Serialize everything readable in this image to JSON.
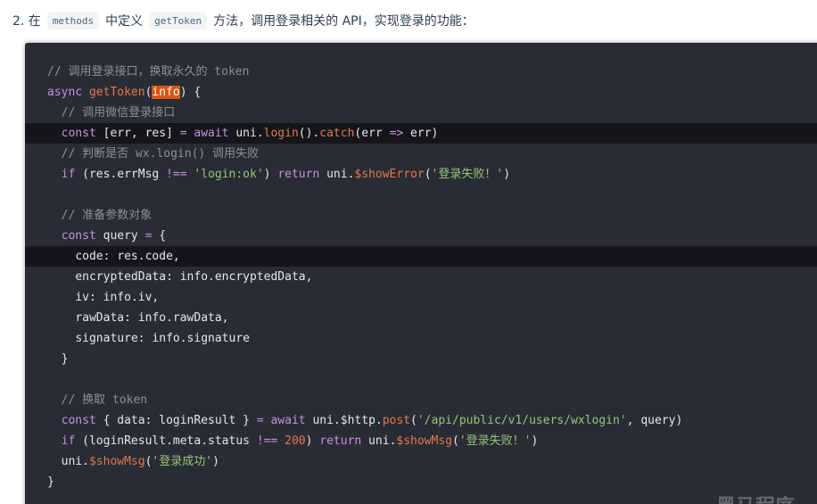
{
  "intro": {
    "prefix": "2. 在",
    "chip1": "methods",
    "mid": "中定义",
    "chip2": "getToken",
    "suffix": "方法，调用登录相关的 API，实现登录的功能："
  },
  "code": {
    "l1": "// 调用登录接口，换取永久的 token",
    "l2_kw": "async",
    "l2_fn": "getToken",
    "l2_open": "(",
    "l2_cursor": "info",
    "l2_close": ") {",
    "l3": "// 调用微信登录接口",
    "l4_a": "const",
    "l4_b": " [err, res] ",
    "l4_c": "=",
    "l4_d": " ",
    "l4_e": "await",
    "l4_f": " uni.",
    "l4_g": "login",
    "l4_h": "().",
    "l4_i": "catch",
    "l4_j": "(err ",
    "l4_k": "=>",
    "l4_l": " err)",
    "l5": "// 判断是否 wx.login() 调用失败",
    "l6_a": "if",
    "l6_b": " (res.errMsg ",
    "l6_c": "!==",
    "l6_d": " ",
    "l6_e": "'login:ok'",
    "l6_f": ") ",
    "l6_g": "return",
    "l6_h": " uni.",
    "l6_i": "$showError",
    "l6_j": "(",
    "l6_k": "'登录失败！'",
    "l6_l": ")",
    "l8": "// 准备参数对象",
    "l9_a": "const",
    "l9_b": " query ",
    "l9_c": "=",
    "l9_d": " {",
    "l10_a": "code",
    "l10_b": ": res.code,",
    "l11_a": "encryptedData",
    "l11_b": ": info.encryptedData,",
    "l12_a": "iv",
    "l12_b": ": info.iv,",
    "l13_a": "rawData",
    "l13_b": ": info.rawData,",
    "l14_a": "signature",
    "l14_b": ": info.signature",
    "l15": "}",
    "l17": "// 换取 token",
    "l18_a": "const",
    "l18_b": " { data",
    "l18_c": ":",
    "l18_d": " loginResult } ",
    "l18_e": "=",
    "l18_f": " ",
    "l18_g": "await",
    "l18_h": " uni.$http.",
    "l18_i": "post",
    "l18_j": "(",
    "l18_k": "'/api/public/v1/users/wxlogin'",
    "l18_l": ", query)",
    "l19_a": "if",
    "l19_b": " (loginResult.meta.status ",
    "l19_c": "!==",
    "l19_d": " ",
    "l19_e": "200",
    "l19_f": ") ",
    "l19_g": "return",
    "l19_h": " uni.",
    "l19_i": "$showMsg",
    "l19_j": "(",
    "l19_k": "'登录失败！'",
    "l19_l": ")",
    "l20_a": "uni.",
    "l20_b": "$showMsg",
    "l20_c": "(",
    "l20_d": "'登录成功'",
    "l20_e": ")",
    "l21": "}"
  },
  "watermark": "黑马程序"
}
